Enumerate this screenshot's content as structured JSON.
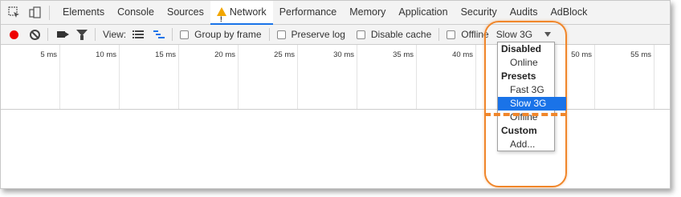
{
  "tabs": [
    {
      "label": "Elements",
      "active": false
    },
    {
      "label": "Console",
      "active": false
    },
    {
      "label": "Sources",
      "active": false
    },
    {
      "label": "Network",
      "active": true,
      "icon": "warning-icon"
    },
    {
      "label": "Performance",
      "active": false
    },
    {
      "label": "Memory",
      "active": false
    },
    {
      "label": "Application",
      "active": false
    },
    {
      "label": "Security",
      "active": false
    },
    {
      "label": "Audits",
      "active": false
    },
    {
      "label": "AdBlock",
      "active": false
    }
  ],
  "tabbar_icons": [
    "inspect-element-icon",
    "device-toolbar-icon"
  ],
  "toolbar": {
    "record_icon": "record-icon",
    "clear_icon": "clear-icon",
    "screenshot_icon": "camera-icon",
    "filter_icon": "filter-icon",
    "view_label": "View:",
    "group_by_frame": "Group by frame",
    "preserve_log": "Preserve log",
    "disable_cache": "Disable cache",
    "offline": "Offline",
    "throttle_value": "Slow 3G"
  },
  "timeline": {
    "ticks": [
      "5 ms",
      "10 ms",
      "15 ms",
      "20 ms",
      "25 ms",
      "30 ms",
      "35 ms",
      "40 ms",
      "45 ms",
      "50 ms",
      "55 ms"
    ]
  },
  "throttle_dropdown": {
    "items": [
      {
        "type": "header",
        "label": "Disabled"
      },
      {
        "type": "option",
        "label": "Online",
        "selected": false
      },
      {
        "type": "header",
        "label": "Presets"
      },
      {
        "type": "option",
        "label": "Fast 3G",
        "selected": false
      },
      {
        "type": "option",
        "label": "Slow 3G",
        "selected": true
      },
      {
        "type": "option",
        "label": "Offline",
        "selected": false
      },
      {
        "type": "header",
        "label": "Custom"
      },
      {
        "type": "option",
        "label": "Add...",
        "selected": false
      }
    ]
  },
  "colors": {
    "accent": "#1a73e8",
    "record": "#ee0000",
    "callout": "#f0862a",
    "warning": "#f2a600"
  }
}
